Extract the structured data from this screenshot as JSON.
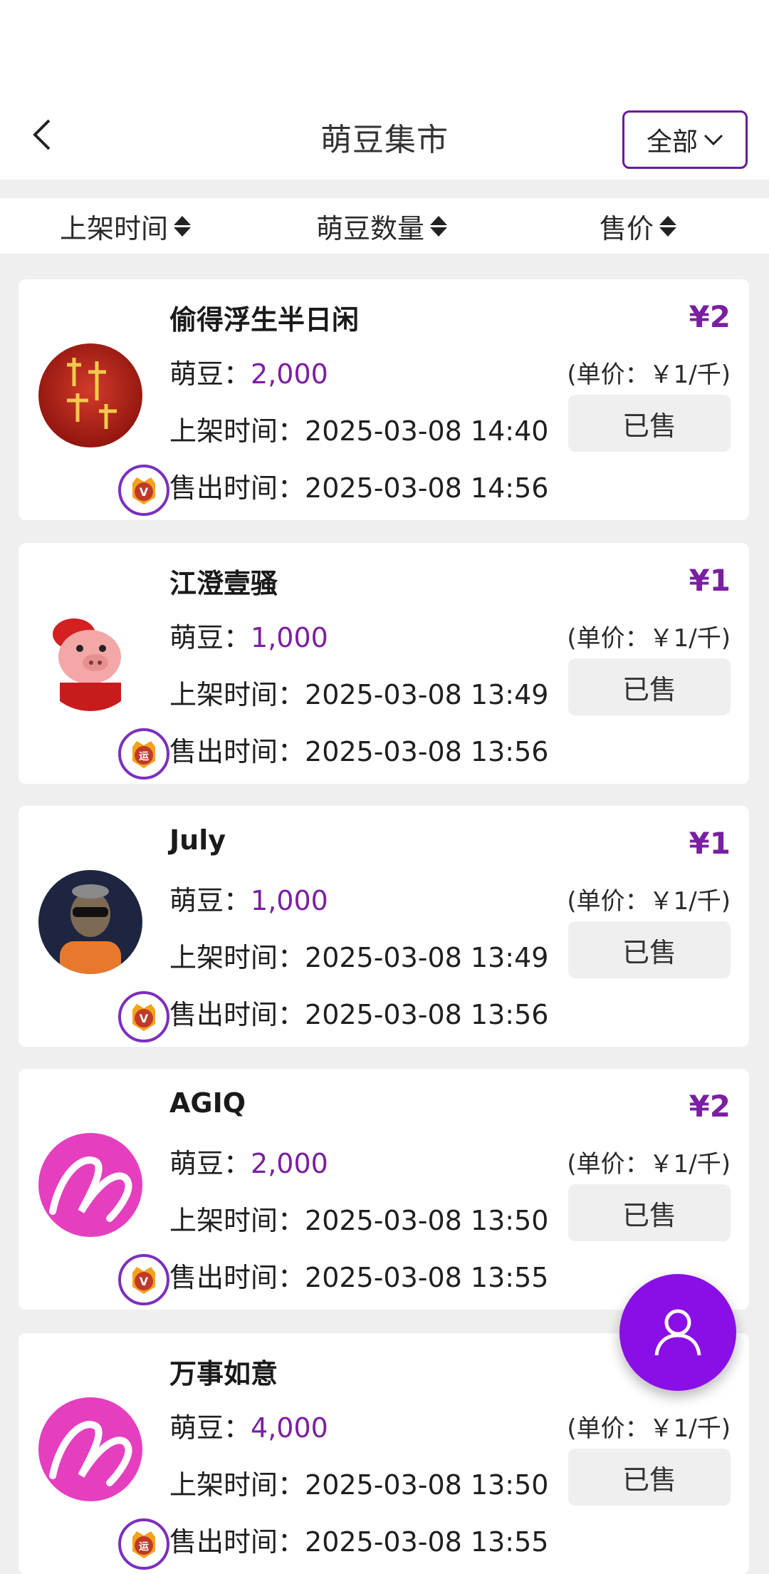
{
  "header": {
    "back_icon": "chevron-left-icon",
    "title": "萌豆集市",
    "filter_label": "全部",
    "filter_icon": "chevron-down-icon"
  },
  "sort": {
    "listed_time": "上架时间",
    "bean_count": "萌豆数量",
    "price": "售价"
  },
  "labels": {
    "beans": "萌豆：",
    "listed": "上架时间：",
    "sold": "售出时间：",
    "sold_status": "已售"
  },
  "listings": [
    {
      "name": "偷得浮生半日闲",
      "beans": "2,000",
      "listed": "2025-03-08 14:40",
      "sold": "2025-03-08 14:56",
      "price": "¥2",
      "unit_price": "(单价：￥1/千)",
      "badge": "V",
      "avatar": "red-calligraphy-avatar"
    },
    {
      "name": "江澄壹骚",
      "beans": "1,000",
      "listed": "2025-03-08 13:49",
      "sold": "2025-03-08 13:56",
      "price": "¥1",
      "unit_price": "(单价：￥1/千)",
      "badge": "运",
      "avatar": "pig-cartoon-avatar"
    },
    {
      "name": "July",
      "beans": "1,000",
      "listed": "2025-03-08 13:49",
      "sold": "2025-03-08 13:56",
      "price": "¥1",
      "unit_price": "(单价：￥1/千)",
      "badge": "V",
      "avatar": "ape-avatar"
    },
    {
      "name": "AGIQ",
      "beans": "2,000",
      "listed": "2025-03-08 13:50",
      "sold": "2025-03-08 13:55",
      "price": "¥2",
      "unit_price": "(单价：￥1/千)",
      "badge": "V",
      "avatar": "magenta-logo-avatar"
    },
    {
      "name": "万事如意",
      "beans": "4,000",
      "listed": "2025-03-08 13:50",
      "sold": "2025-03-08 13:55",
      "price": "",
      "unit_price": "(单价：￥1/千)",
      "badge": "运",
      "avatar": "magenta-logo-avatar"
    }
  ],
  "fab": {
    "icon": "user-icon"
  },
  "colors": {
    "accent": "#7b1fa2",
    "fab": "#8a0ee6"
  }
}
